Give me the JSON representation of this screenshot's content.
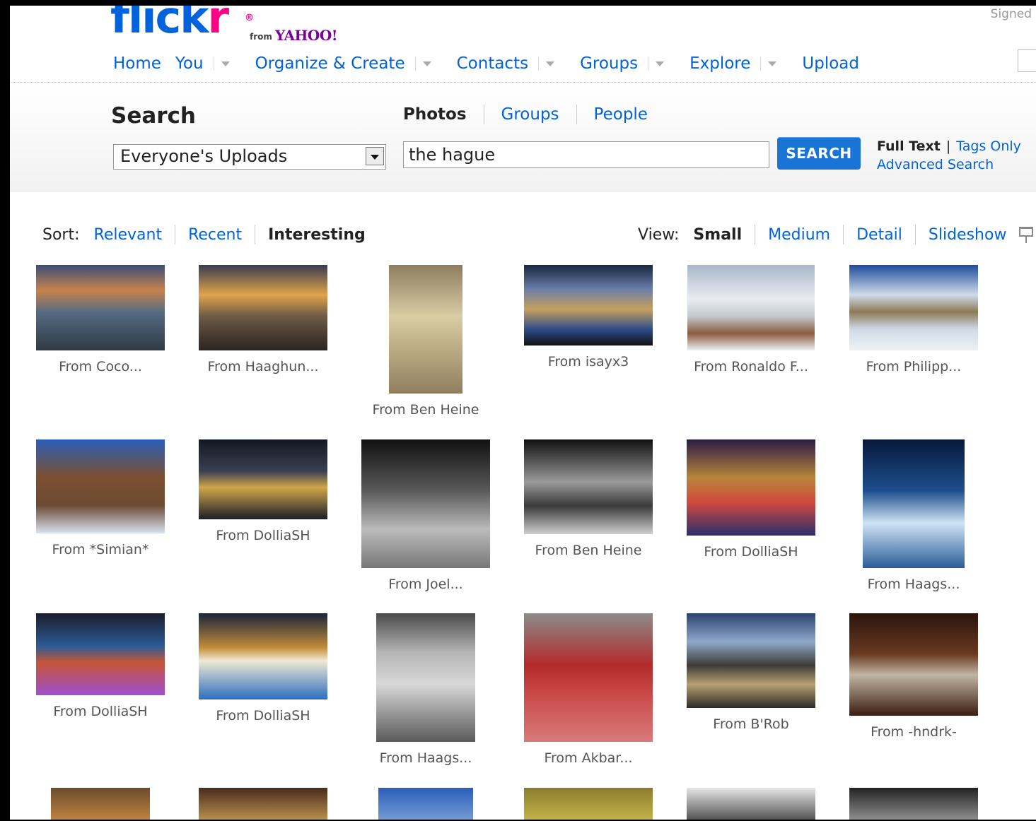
{
  "header": {
    "logo_main": "flick",
    "logo_r": "r",
    "logo_reg": "®",
    "logo_from": "from",
    "logo_yahoo": "YAHOO!",
    "signed": "Signed",
    "nav": [
      {
        "label": "Home",
        "menu": false
      },
      {
        "label": "You",
        "menu": true
      },
      {
        "label": "Organize & Create",
        "menu": true
      },
      {
        "label": "Contacts",
        "menu": true
      },
      {
        "label": "Groups",
        "menu": true
      },
      {
        "label": "Explore",
        "menu": true
      },
      {
        "label": "Upload",
        "menu": false
      }
    ]
  },
  "search": {
    "title": "Search",
    "scope_value": "Everyone's Uploads",
    "tabs": {
      "photos": "Photos",
      "groups": "Groups",
      "people": "People"
    },
    "query": "the hague",
    "button": "SEARCH",
    "full_text": "Full Text",
    "pipe": "|",
    "tags_only": "Tags Only",
    "advanced": "Advanced Search"
  },
  "sort": {
    "label": "Sort:",
    "relevant": "Relevant",
    "recent": "Recent",
    "interesting": "Interesting"
  },
  "view": {
    "label": "View:",
    "small": "Small",
    "medium": "Medium",
    "detail": "Detail",
    "slideshow": "Slideshow"
  },
  "results": [
    {
      "caption": "From Coco..."
    },
    {
      "caption": "From Haaghun..."
    },
    {
      "caption": "From Ben Heine"
    },
    {
      "caption": "From isayx3"
    },
    {
      "caption": "From Ronaldo F..."
    },
    {
      "caption": "From Philipp..."
    },
    {
      "caption": "From *Simian*"
    },
    {
      "caption": "From DolliaSH"
    },
    {
      "caption": "From Joel..."
    },
    {
      "caption": "From Ben Heine"
    },
    {
      "caption": "From DolliaSH"
    },
    {
      "caption": "From Haags..."
    },
    {
      "caption": "From DolliaSH"
    },
    {
      "caption": "From DolliaSH"
    },
    {
      "caption": "From Haags..."
    },
    {
      "caption": "From Akbar..."
    },
    {
      "caption": "From B'Rob"
    },
    {
      "caption": "From -hndrk-"
    },
    {
      "caption": ""
    },
    {
      "caption": ""
    },
    {
      "caption": ""
    },
    {
      "caption": ""
    },
    {
      "caption": ""
    },
    {
      "caption": ""
    }
  ],
  "colors": {
    "link": "#0063dc",
    "pink": "#ff0084",
    "button": "#1a74d6"
  }
}
